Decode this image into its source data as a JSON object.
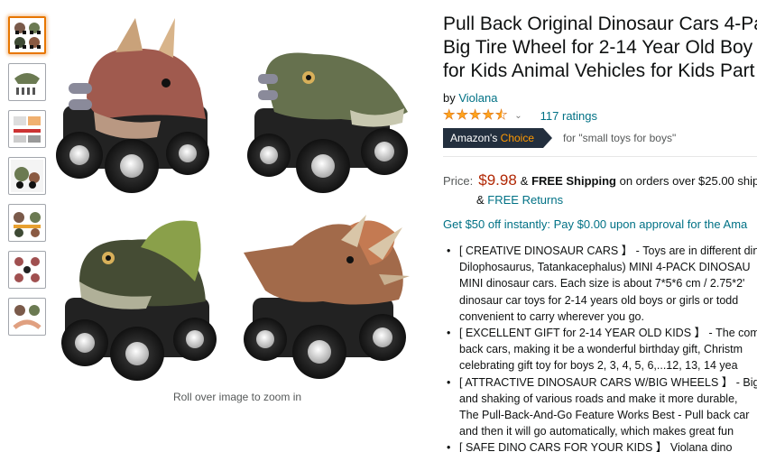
{
  "thumbnails": [
    {
      "name": "thumb-1",
      "selected": true
    },
    {
      "name": "thumb-2",
      "selected": false
    },
    {
      "name": "thumb-3",
      "selected": false
    },
    {
      "name": "thumb-4",
      "selected": false
    },
    {
      "name": "thumb-5",
      "selected": false
    },
    {
      "name": "thumb-6",
      "selected": false
    },
    {
      "name": "thumb-7",
      "selected": false
    }
  ],
  "zoom_hint": "Roll over image to zoom in",
  "product": {
    "title_lines": [
      "Pull Back Original Dinosaur Cars 4-Pa",
      "Big Tire Wheel for 2-14 Year Old Boy",
      "for Kids Animal Vehicles for Kids Part"
    ],
    "by_prefix": "by",
    "brand": "Violana",
    "rating_stars": 4.5,
    "ratings_count": "117 ratings",
    "badge_primary": "Amazon's",
    "badge_accent": "Choice",
    "choice_query": "for \"small toys for boys\"",
    "price_label": "Price:",
    "price": "$9.98",
    "shipping_amp": "&",
    "free_shipping": "FREE Shipping",
    "shipping_rest": "on orders over $25.00 ship",
    "returns_amp": "&",
    "free_returns": "FREE Returns",
    "offer": "Get $50 off instantly: Pay $0.00 upon approval for the Ama",
    "bullets": [
      [
        "[ CREATIVE DINOSAUR CARS 】 - Toys are in different din",
        "Dilophosaurus, Tatankacephalus) MINI 4-PACK DINOSAU",
        "MINI dinosaur cars. Each size is about 7*5*6 cm / 2.75*2'",
        "dinosaur car toys for 2-14 years old boys or girls or todd",
        "convenient to carry wherever you go."
      ],
      [
        "[ EXCELLENT GIFT for 2-14 YEAR OLD KIDS 】 - The comb",
        "back cars, making it be a wonderful birthday gift, Christm",
        "celebrating gift toy for boys 2, 3, 4, 5, 6,...12, 13, 14 yea"
      ],
      [
        "[ ATTRACTIVE DINOSAUR CARS W/BIG WHEELS 】 - Big t",
        "and shaking of various roads and make it more durable,",
        "The Pull-Back-And-Go Feature Works Best - Pull back car",
        "and then it will go automatically, which makes great fun"
      ],
      [
        "[ SAFE DINO CARS FOR YOUR KIDS 】 Violana dino"
      ]
    ]
  },
  "colors": {
    "link": "#007185",
    "price": "#b12704",
    "badge_bg": "#232f3e",
    "badge_accent": "#ff9900",
    "star": "#ffa41c",
    "thumb_selected": "#e77600"
  }
}
